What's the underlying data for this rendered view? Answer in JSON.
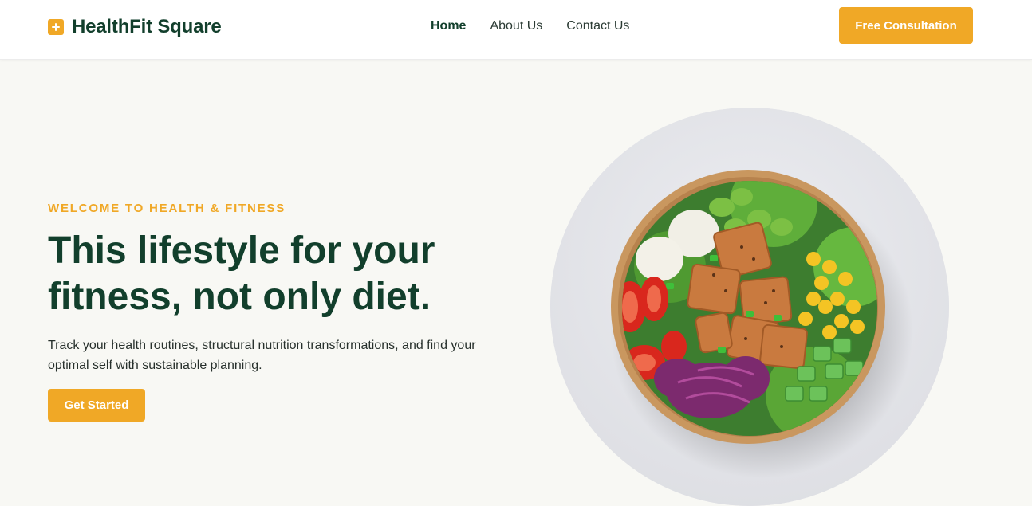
{
  "brand": {
    "name": "HealthFit Square",
    "icon": "plus-square-icon",
    "accent_color": "#f0a826",
    "primary_color": "#123f2c"
  },
  "nav": {
    "items": [
      {
        "label": "Home",
        "active": true
      },
      {
        "label": "About Us",
        "active": false
      },
      {
        "label": "Contact Us",
        "active": false
      }
    ]
  },
  "header": {
    "cta_label": "Free Consultation"
  },
  "hero": {
    "eyebrow": "WELCOME TO HEALTH & FITNESS",
    "title_line1": "This lifestyle for your",
    "title_line2": "fitness, not only diet.",
    "description_line1": "Track your health routines, structural nutrition transformations, and find your",
    "description_line2": "optimal self with sustainable planning.",
    "button_label": "Get Started",
    "image": "salad-bowl-image"
  }
}
